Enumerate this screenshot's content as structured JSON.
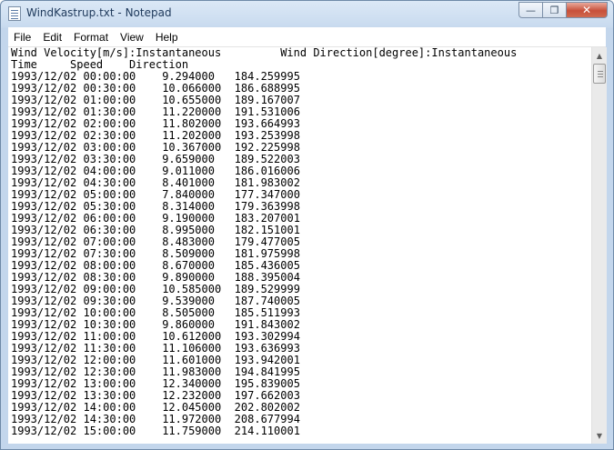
{
  "window": {
    "title": "WindKastrup.txt - Notepad",
    "controls": {
      "minimize": "—",
      "maximize": "❐",
      "close": "✕"
    }
  },
  "menu": [
    "File",
    "Edit",
    "Format",
    "View",
    "Help"
  ],
  "document": {
    "header_line1": "Wind Velocity[m/s]:Instantaneous         Wind Direction[degree]:Instantaneous",
    "header_line2": "Time     Speed    Direction",
    "rows": [
      [
        "1993/12/02 00:00:00",
        "9.294000",
        "184.259995"
      ],
      [
        "1993/12/02 00:30:00",
        "10.066000",
        "186.688995"
      ],
      [
        "1993/12/02 01:00:00",
        "10.655000",
        "189.167007"
      ],
      [
        "1993/12/02 01:30:00",
        "11.220000",
        "191.531006"
      ],
      [
        "1993/12/02 02:00:00",
        "11.802000",
        "193.664993"
      ],
      [
        "1993/12/02 02:30:00",
        "11.202000",
        "193.253998"
      ],
      [
        "1993/12/02 03:00:00",
        "10.367000",
        "192.225998"
      ],
      [
        "1993/12/02 03:30:00",
        "9.659000",
        "189.522003"
      ],
      [
        "1993/12/02 04:00:00",
        "9.011000",
        "186.016006"
      ],
      [
        "1993/12/02 04:30:00",
        "8.401000",
        "181.983002"
      ],
      [
        "1993/12/02 05:00:00",
        "7.840000",
        "177.347000"
      ],
      [
        "1993/12/02 05:30:00",
        "8.314000",
        "179.363998"
      ],
      [
        "1993/12/02 06:00:00",
        "9.190000",
        "183.207001"
      ],
      [
        "1993/12/02 06:30:00",
        "8.995000",
        "182.151001"
      ],
      [
        "1993/12/02 07:00:00",
        "8.483000",
        "179.477005"
      ],
      [
        "1993/12/02 07:30:00",
        "8.509000",
        "181.975998"
      ],
      [
        "1993/12/02 08:00:00",
        "8.670000",
        "185.436005"
      ],
      [
        "1993/12/02 08:30:00",
        "9.890000",
        "188.395004"
      ],
      [
        "1993/12/02 09:00:00",
        "10.585000",
        "189.529999"
      ],
      [
        "1993/12/02 09:30:00",
        "9.539000",
        "187.740005"
      ],
      [
        "1993/12/02 10:00:00",
        "8.505000",
        "185.511993"
      ],
      [
        "1993/12/02 10:30:00",
        "9.860000",
        "191.843002"
      ],
      [
        "1993/12/02 11:00:00",
        "10.612000",
        "193.302994"
      ],
      [
        "1993/12/02 11:30:00",
        "11.106000",
        "193.636993"
      ],
      [
        "1993/12/02 12:00:00",
        "11.601000",
        "193.942001"
      ],
      [
        "1993/12/02 12:30:00",
        "11.983000",
        "194.841995"
      ],
      [
        "1993/12/02 13:00:00",
        "12.340000",
        "195.839005"
      ],
      [
        "1993/12/02 13:30:00",
        "12.232000",
        "197.662003"
      ],
      [
        "1993/12/02 14:00:00",
        "12.045000",
        "202.802002"
      ],
      [
        "1993/12/02 14:30:00",
        "11.972000",
        "208.677994"
      ],
      [
        "1993/12/02 15:00:00",
        "11.759000",
        "214.110001"
      ]
    ]
  },
  "scrollbar": {
    "up_arrow": "▲",
    "down_arrow": "▼"
  }
}
